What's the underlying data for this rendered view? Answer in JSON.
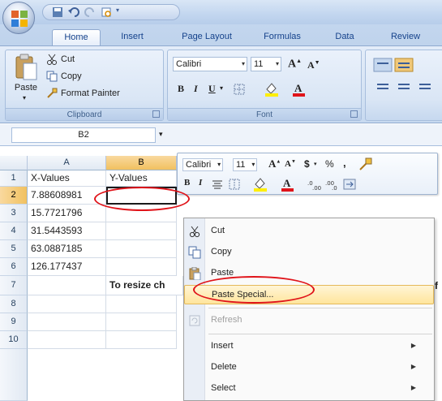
{
  "quick_access": {
    "save": "save-icon",
    "undo": "undo-icon",
    "redo": "redo-icon"
  },
  "tabs": [
    {
      "label": "Home"
    },
    {
      "label": "Insert"
    },
    {
      "label": "Page Layout"
    },
    {
      "label": "Formulas"
    },
    {
      "label": "Data"
    },
    {
      "label": "Review"
    }
  ],
  "clipboard": {
    "paste": "Paste",
    "cut": "Cut",
    "copy": "Copy",
    "format_painter": "Format Painter",
    "group_label": "Clipboard"
  },
  "font": {
    "family": "Calibri",
    "size": "11",
    "bold": "B",
    "italic": "I",
    "underline": "U",
    "group_label": "Font"
  },
  "name_box": "B2",
  "columns": [
    "A",
    "B"
  ],
  "rows": [
    "1",
    "2",
    "3",
    "4",
    "5",
    "6",
    "7",
    "8",
    "9",
    "10"
  ],
  "cells": {
    "a1": "X-Values",
    "b1": "Y-Values",
    "a2": "7.88608981",
    "a3": "15.7721796",
    "a4": "31.5443593",
    "a5": "63.0887185",
    "a6": "126.177437",
    "b7": "To resize ch",
    "trailing": "f"
  },
  "mini_toolbar": {
    "font": "Calibri",
    "size": "11",
    "currency": "$",
    "percent": "%",
    "comma": ",",
    "bold": "B",
    "italic": "I"
  },
  "context_menu": [
    {
      "label": "Cut",
      "icon": "scissors-icon",
      "enabled": true
    },
    {
      "label": "Copy",
      "icon": "copy-icon",
      "enabled": true
    },
    {
      "label": "Paste",
      "icon": "paste-icon",
      "enabled": true
    },
    {
      "label": "Paste Special...",
      "icon": "",
      "enabled": true,
      "highlighted": true
    },
    {
      "label": "Refresh",
      "icon": "refresh-icon",
      "enabled": false
    },
    {
      "label": "Insert",
      "icon": "",
      "enabled": true,
      "submenu": true
    },
    {
      "label": "Delete",
      "icon": "",
      "enabled": true,
      "submenu": true
    },
    {
      "label": "Select",
      "icon": "",
      "enabled": true,
      "submenu": true
    }
  ],
  "colors": {
    "annotation": "#e0141a",
    "selection": "#f1c15f",
    "ribbon": "#d7e4f4"
  }
}
